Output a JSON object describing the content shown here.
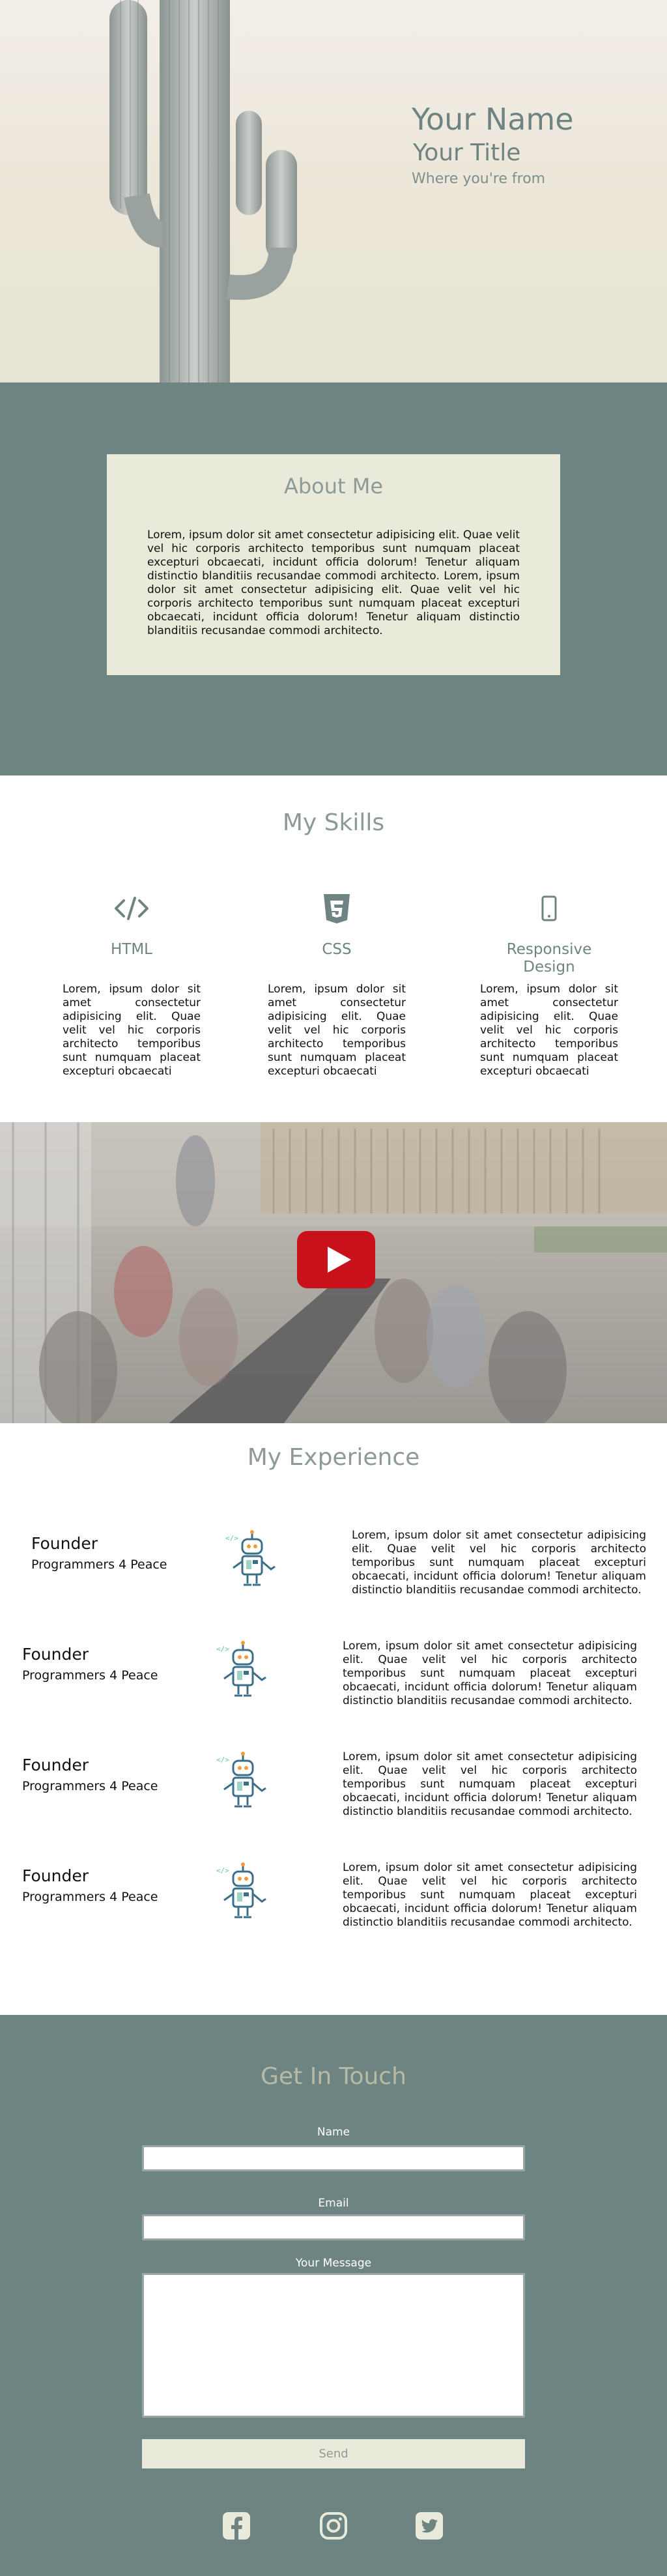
{
  "hero": {
    "name": "Your Name",
    "title": "Your Title",
    "from": "Where you're from"
  },
  "about": {
    "heading": "About Me",
    "text": "Lorem, ipsum dolor sit amet consectetur adipisicing elit. Quae velit vel hic corporis architecto temporibus sunt numquam placeat excepturi obcaecati, incidunt officia dolorum! Tenetur aliquam distinctio blanditiis recusandae commodi architecto. Lorem, ipsum dolor sit amet consectetur adipisicing elit. Quae velit vel hic corporis architecto temporibus sunt numquam placeat excepturi obcaecati, incidunt officia dolorum! Tenetur aliquam distinctio blanditiis recusandae commodi architecto."
  },
  "skills": {
    "heading": "My Skills",
    "items": [
      {
        "icon": "code-icon",
        "name": "HTML",
        "text": "Lorem, ipsum dolor sit amet consectetur adipisicing elit. Quae velit vel hic corporis architecto temporibus sunt numquam placeat excepturi obcaecati"
      },
      {
        "icon": "css3-icon",
        "name": "CSS",
        "text": "Lorem, ipsum dolor sit amet consectetur adipisicing elit. Quae velit vel hic corporis architecto temporibus sunt numquam placeat excepturi obcaecati"
      },
      {
        "icon": "mobile-icon",
        "name": "Responsive Design",
        "text": "Lorem, ipsum dolor sit amet consectetur adipisicing elit. Quae velit vel hic corporis architecto temporibus sunt numquam placeat excepturi obcaecati"
      }
    ]
  },
  "experience": {
    "heading": "My Experience",
    "items": [
      {
        "role": "Founder",
        "org": "Programmers 4 Peace",
        "icon": "robot-icon",
        "text": "Lorem, ipsum dolor sit amet consectetur adipisicing elit. Quae velit vel hic corporis architecto temporibus sunt numquam placeat excepturi obcaecati, incidunt officia dolorum! Tenetur aliquam distinctio blanditiis recusandae commodi architecto."
      },
      {
        "role": "Founder",
        "org": "Programmers 4 Peace",
        "icon": "robot-icon",
        "text": "Lorem, ipsum dolor sit amet consectetur adipisicing elit. Quae velit vel hic corporis architecto temporibus sunt numquam placeat excepturi obcaecati, incidunt officia dolorum! Tenetur aliquam distinctio blanditiis recusandae commodi architecto."
      },
      {
        "role": "Founder",
        "org": "Programmers 4 Peace",
        "icon": "robot-icon",
        "text": "Lorem, ipsum dolor sit amet consectetur adipisicing elit. Quae velit vel hic corporis architecto temporibus sunt numquam placeat excepturi obcaecati, incidunt officia dolorum! Tenetur aliquam distinctio blanditiis recusandae commodi architecto."
      },
      {
        "role": "Founder",
        "org": "Programmers 4 Peace",
        "icon": "robot-icon",
        "text": "Lorem, ipsum dolor sit amet consectetur adipisicing elit. Quae velit vel hic corporis architecto temporibus sunt numquam placeat excepturi obcaecati, incidunt officia dolorum! Tenetur aliquam distinctio blanditiis recusandae commodi architecto."
      }
    ]
  },
  "contact": {
    "heading": "Get In Touch",
    "name_label": "Name",
    "name_value": "",
    "email_label": "Email",
    "email_value": "",
    "message_label": "Your Message",
    "message_value": "",
    "send_label": "Send",
    "social": [
      "facebook-icon",
      "instagram-icon",
      "twitter-icon"
    ]
  },
  "colors": {
    "accent": "#6e8483",
    "card": "#eaeadb",
    "heading": "#8c9a98",
    "youtube_red": "#c9111b"
  }
}
